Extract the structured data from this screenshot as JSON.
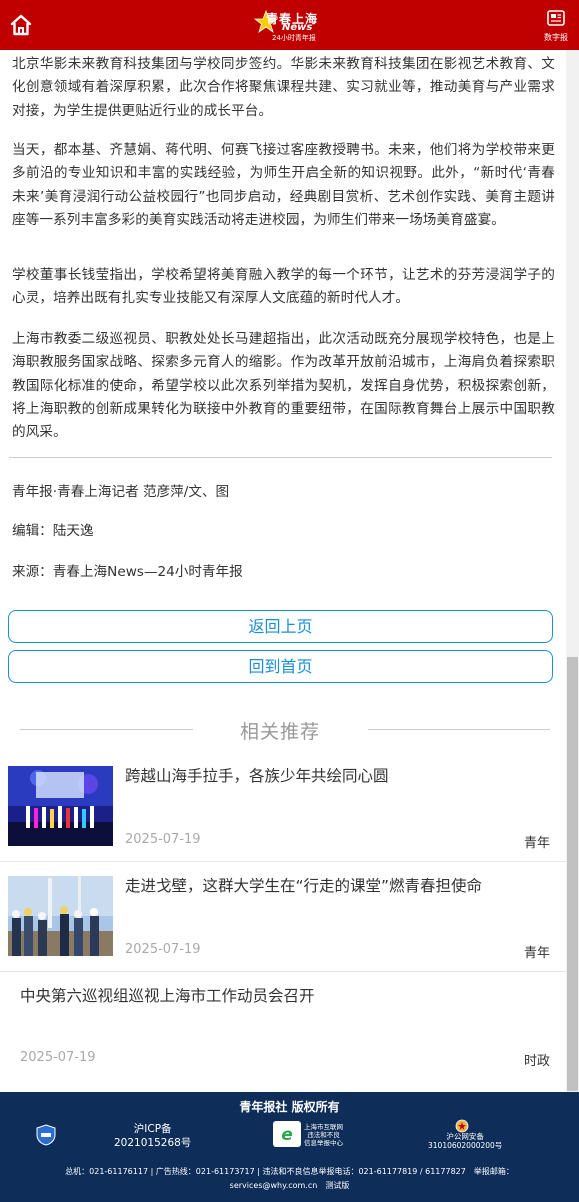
{
  "header": {
    "logo_text": "青春上海",
    "logo_news": "News",
    "logo_sub": "24小时青年报",
    "digital_label": "数字报",
    "brand_color": "#c00000"
  },
  "article": {
    "paragraphs": [
      "北京华影未来教育科技集团与学校同步签约。华影未来教育科技集团在影视艺术教育、文化创意领域有着深厚积累，此次合作将聚焦课程共建、实习就业等，推动美育与产业需求对接，为学生提供更贴近行业的成长平台。",
      "当天，都本基、齐慧娟、蒋代明、何赛飞接过客座教授聘书。未来，他们将为学校带来更多前沿的专业知识和丰富的实践经验，为师生开启全新的知识视野。此外，“新时代‘青春未来’美育浸润行动公益校园行”也同步启动，经典剧目赏析、艺术创作实践、美育主题讲座等一系列丰富多彩的美育实践活动将走进校园，为师生们带来一场场美育盛宴。",
      "学校董事长钱莹指出，学校希望将美育融入教学的每一个环节，让艺术的芬芳浸润学子的心灵，培养出既有扎实专业技能又有深厚人文底蕴的新时代人才。",
      "上海市教委二级巡视员、职教处处长马建超指出，此次活动既充分展现学校特色，也是上海职教服务国家战略、探索多元育人的缩影。作为改革开放前沿城市，上海肩负着探索职教国际化标准的使命，希望学校以此次系列举措为契机，发挥自身优势，积极探索创新，将上海职教的创新成果转化为联接中外教育的重要纽带，在国际教育舞台上展示中国职教的风采。"
    ],
    "byline": "青年报·青春上海记者 范彦萍/文、图",
    "editor": "编辑：陆天逸",
    "source": "来源：青春上海News—24小时青年报"
  },
  "buttons": {
    "back": "返回上页",
    "home": "回到首页",
    "accent_color": "#1a8fd6"
  },
  "related": {
    "heading": "相关推荐",
    "items": [
      {
        "title": "跨越山海手拉手，各族少年共绘同心圆",
        "date": "2025-07-19",
        "category": "青年",
        "has_image": true
      },
      {
        "title": "走进戈壁，这群大学生在“行走的课堂”燃青春担使命",
        "date": "2025-07-19",
        "category": "青年",
        "has_image": true
      },
      {
        "title": "中央第六巡视组巡视上海市工作动员会召开",
        "date": "2025-07-19",
        "category": "时政",
        "has_image": false
      }
    ]
  },
  "footer": {
    "title": "青年报社 版权所有",
    "icp_line1": "沪ICP备",
    "icp_line2": "2021015268号",
    "report_line1": "上海市互联网",
    "report_line2": "违法和不良",
    "report_line3": "信息举报中心",
    "police_line1": "沪公网安备",
    "police_line2": "31010602000200号",
    "contact_line1": "总机：021-61176117 | 广告热线：021-61173717 | 违法和不良信息举报电话：021-61177819 / 61177827　举报邮箱：",
    "contact_line2": "services@why.com.cn　测试版",
    "bg_color": "#0e2d59"
  }
}
